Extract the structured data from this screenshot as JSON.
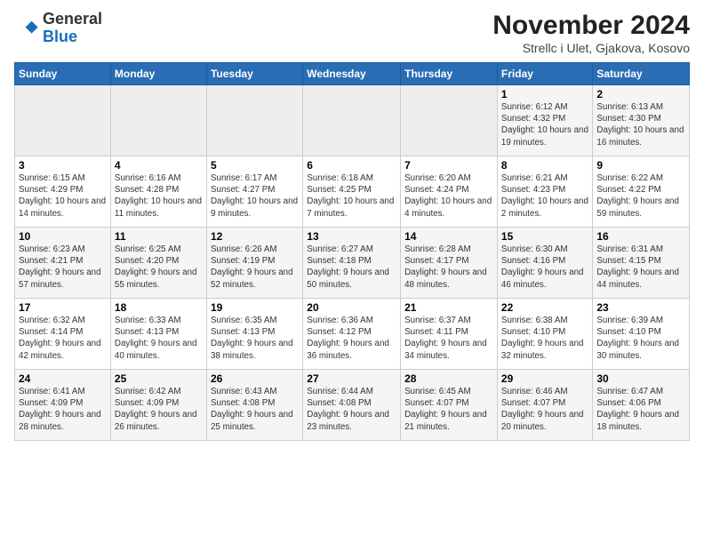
{
  "header": {
    "logo_general": "General",
    "logo_blue": "Blue",
    "month_title": "November 2024",
    "location": "Strellc i Ulet, Gjakova, Kosovo"
  },
  "weekdays": [
    "Sunday",
    "Monday",
    "Tuesday",
    "Wednesday",
    "Thursday",
    "Friday",
    "Saturday"
  ],
  "weeks": [
    [
      {
        "day": "",
        "empty": true
      },
      {
        "day": "",
        "empty": true
      },
      {
        "day": "",
        "empty": true
      },
      {
        "day": "",
        "empty": true
      },
      {
        "day": "",
        "empty": true
      },
      {
        "day": "1",
        "sunrise": "6:12 AM",
        "sunset": "4:32 PM",
        "daylight": "10 hours and 19 minutes."
      },
      {
        "day": "2",
        "sunrise": "6:13 AM",
        "sunset": "4:30 PM",
        "daylight": "10 hours and 16 minutes."
      }
    ],
    [
      {
        "day": "3",
        "sunrise": "6:15 AM",
        "sunset": "4:29 PM",
        "daylight": "10 hours and 14 minutes."
      },
      {
        "day": "4",
        "sunrise": "6:16 AM",
        "sunset": "4:28 PM",
        "daylight": "10 hours and 11 minutes."
      },
      {
        "day": "5",
        "sunrise": "6:17 AM",
        "sunset": "4:27 PM",
        "daylight": "10 hours and 9 minutes."
      },
      {
        "day": "6",
        "sunrise": "6:18 AM",
        "sunset": "4:25 PM",
        "daylight": "10 hours and 7 minutes."
      },
      {
        "day": "7",
        "sunrise": "6:20 AM",
        "sunset": "4:24 PM",
        "daylight": "10 hours and 4 minutes."
      },
      {
        "day": "8",
        "sunrise": "6:21 AM",
        "sunset": "4:23 PM",
        "daylight": "10 hours and 2 minutes."
      },
      {
        "day": "9",
        "sunrise": "6:22 AM",
        "sunset": "4:22 PM",
        "daylight": "9 hours and 59 minutes."
      }
    ],
    [
      {
        "day": "10",
        "sunrise": "6:23 AM",
        "sunset": "4:21 PM",
        "daylight": "9 hours and 57 minutes."
      },
      {
        "day": "11",
        "sunrise": "6:25 AM",
        "sunset": "4:20 PM",
        "daylight": "9 hours and 55 minutes."
      },
      {
        "day": "12",
        "sunrise": "6:26 AM",
        "sunset": "4:19 PM",
        "daylight": "9 hours and 52 minutes."
      },
      {
        "day": "13",
        "sunrise": "6:27 AM",
        "sunset": "4:18 PM",
        "daylight": "9 hours and 50 minutes."
      },
      {
        "day": "14",
        "sunrise": "6:28 AM",
        "sunset": "4:17 PM",
        "daylight": "9 hours and 48 minutes."
      },
      {
        "day": "15",
        "sunrise": "6:30 AM",
        "sunset": "4:16 PM",
        "daylight": "9 hours and 46 minutes."
      },
      {
        "day": "16",
        "sunrise": "6:31 AM",
        "sunset": "4:15 PM",
        "daylight": "9 hours and 44 minutes."
      }
    ],
    [
      {
        "day": "17",
        "sunrise": "6:32 AM",
        "sunset": "4:14 PM",
        "daylight": "9 hours and 42 minutes."
      },
      {
        "day": "18",
        "sunrise": "6:33 AM",
        "sunset": "4:13 PM",
        "daylight": "9 hours and 40 minutes."
      },
      {
        "day": "19",
        "sunrise": "6:35 AM",
        "sunset": "4:13 PM",
        "daylight": "9 hours and 38 minutes."
      },
      {
        "day": "20",
        "sunrise": "6:36 AM",
        "sunset": "4:12 PM",
        "daylight": "9 hours and 36 minutes."
      },
      {
        "day": "21",
        "sunrise": "6:37 AM",
        "sunset": "4:11 PM",
        "daylight": "9 hours and 34 minutes."
      },
      {
        "day": "22",
        "sunrise": "6:38 AM",
        "sunset": "4:10 PM",
        "daylight": "9 hours and 32 minutes."
      },
      {
        "day": "23",
        "sunrise": "6:39 AM",
        "sunset": "4:10 PM",
        "daylight": "9 hours and 30 minutes."
      }
    ],
    [
      {
        "day": "24",
        "sunrise": "6:41 AM",
        "sunset": "4:09 PM",
        "daylight": "9 hours and 28 minutes."
      },
      {
        "day": "25",
        "sunrise": "6:42 AM",
        "sunset": "4:09 PM",
        "daylight": "9 hours and 26 minutes."
      },
      {
        "day": "26",
        "sunrise": "6:43 AM",
        "sunset": "4:08 PM",
        "daylight": "9 hours and 25 minutes."
      },
      {
        "day": "27",
        "sunrise": "6:44 AM",
        "sunset": "4:08 PM",
        "daylight": "9 hours and 23 minutes."
      },
      {
        "day": "28",
        "sunrise": "6:45 AM",
        "sunset": "4:07 PM",
        "daylight": "9 hours and 21 minutes."
      },
      {
        "day": "29",
        "sunrise": "6:46 AM",
        "sunset": "4:07 PM",
        "daylight": "9 hours and 20 minutes."
      },
      {
        "day": "30",
        "sunrise": "6:47 AM",
        "sunset": "4:06 PM",
        "daylight": "9 hours and 18 minutes."
      }
    ]
  ],
  "labels": {
    "sunrise": "Sunrise:",
    "sunset": "Sunset:",
    "daylight": "Daylight:"
  }
}
